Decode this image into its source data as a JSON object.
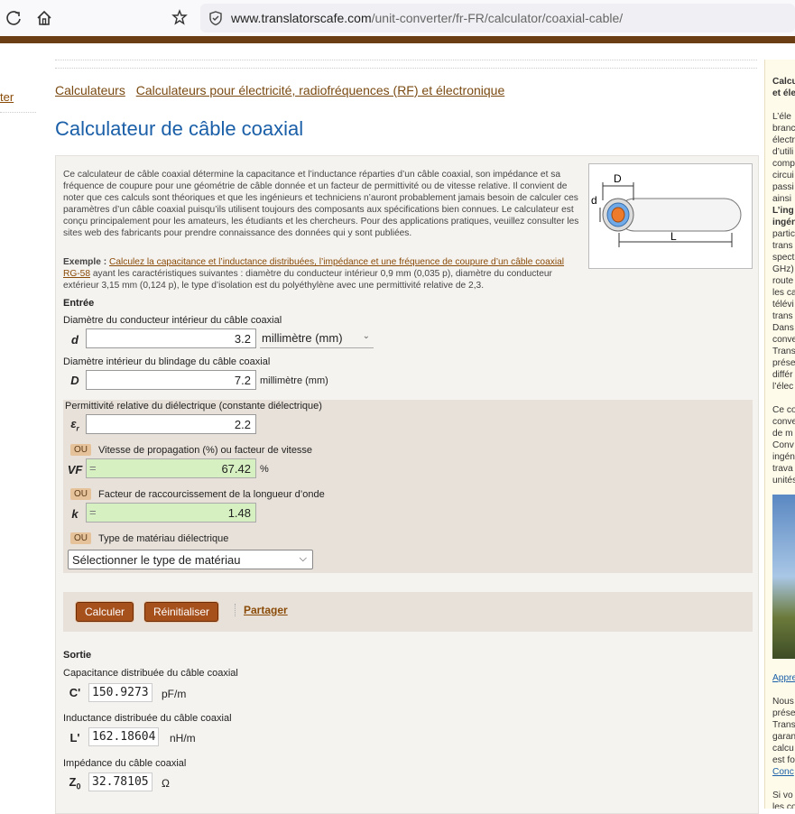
{
  "browser": {
    "url_host": "www.translatorscafe.com",
    "url_path": "/unit-converter/fr-FR/calculator/coaxial-cable/"
  },
  "left_nav": {
    "link": "ter"
  },
  "breadcrumb": [
    "Calculateurs",
    "Calculateurs pour électricité, radiofréquences (RF) et électronique"
  ],
  "title": "Calculateur de câble coaxial",
  "intro": "Ce calculateur de câble coaxial détermine la capacitance et l’inductance réparties d’un câble coaxial, son impédance et sa fréquence de coupure pour une géométrie de câble donnée et un facteur de permittivité ou de vitesse relative. Il convient de noter que ces calculs sont théoriques et que les ingénieurs et techniciens n’auront probablement jamais besoin de calculer ces paramètres d’un câble coaxial puisqu’ils utilisent toujours des composants aux spécifications bien connues. Le calculateur est conçu principalement pour les amateurs, les étudiants et les chercheurs. Pour des applications pratiques, veuillez consulter les sites web des fabricants pour prendre connaissance des données qui y sont publiées.",
  "example": {
    "label": "Exemple :",
    "link": "Calculez la capacitance et l’inductance distribuées, l’impédance et une fréquence de coupure d’un câble coaxial RG-58",
    "rest": " ayant les caractéristiques suivantes : diamètre du conducteur intérieur 0,9 mm (0,035 p), diamètre du conducteur extérieur 3,15 mm (0,124 p), le type d’isolation est du polyéthylène avec une permittivité relative de 2,3."
  },
  "diagram": {
    "d": "d",
    "D": "D",
    "L": "L"
  },
  "input": {
    "heading": "Entrée",
    "d": {
      "label": "Diamètre du conducteur intérieur du câble coaxial",
      "sym": "d",
      "value": "3.2",
      "unit": "millimètre (mm)"
    },
    "D": {
      "label": "Diamètre intérieur du blindage du câble coaxial",
      "sym": "D",
      "value": "7.2",
      "unit": "millimètre (mm)"
    },
    "er": {
      "label": "Permittivité relative du diélectrique (constante diélectrique)",
      "sym": "ε",
      "sub": "r",
      "value": "2.2"
    },
    "or": "OU",
    "vf": {
      "label": "Vitesse de propagation (%) ou facteur de vitesse",
      "sym": "VF",
      "value": "67.42",
      "unit": "%"
    },
    "k": {
      "label": "Facteur de raccourcissement de la longueur d’onde",
      "sym": "k",
      "value": "1.48"
    },
    "mat": {
      "label": "Type de matériau diélectrique",
      "select": "Sélectionner le type de matériau"
    }
  },
  "buttons": {
    "calc": "Calculer",
    "reset": "Réinitialiser",
    "share": "Partager"
  },
  "output": {
    "heading": "Sortie",
    "cap": {
      "label": "Capacitance distribuée du câble coaxial",
      "sym": "C'",
      "value": "150.9273",
      "unit": "pF/m"
    },
    "ind": {
      "label": "Inductance distribuée du câble coaxial",
      "sym": "L'",
      "value": "162.18604",
      "unit": "nH/m"
    },
    "imp": {
      "label": "Impédance du câble coaxial",
      "sym": "Z",
      "sub": "0",
      "value": "32.78105",
      "unit": "Ω"
    }
  },
  "sidebar": {
    "lines": [
      "Calcu",
      "et éle",
      "",
      "L’éle",
      "branc",
      "électr",
      "d’utili",
      "comp",
      "circui",
      "passi",
      "ainsi",
      "L’ing",
      "ingén",
      "partic",
      "trans",
      "spect",
      "GHz)",
      "route",
      "les ca",
      "télévi",
      "trans",
      "Dans",
      "conve",
      "Trans",
      "prése",
      "différ",
      "l’élec",
      "",
      "Ce co",
      "conve",
      "de m",
      "Conv",
      "ingén",
      "trava",
      "unités"
    ],
    "lines2": [
      "Appre",
      "",
      "Nous",
      "prése",
      "Trans",
      "garan",
      "calcu",
      "est fo",
      "Conc",
      "",
      "Si vo",
      "les co"
    ]
  }
}
